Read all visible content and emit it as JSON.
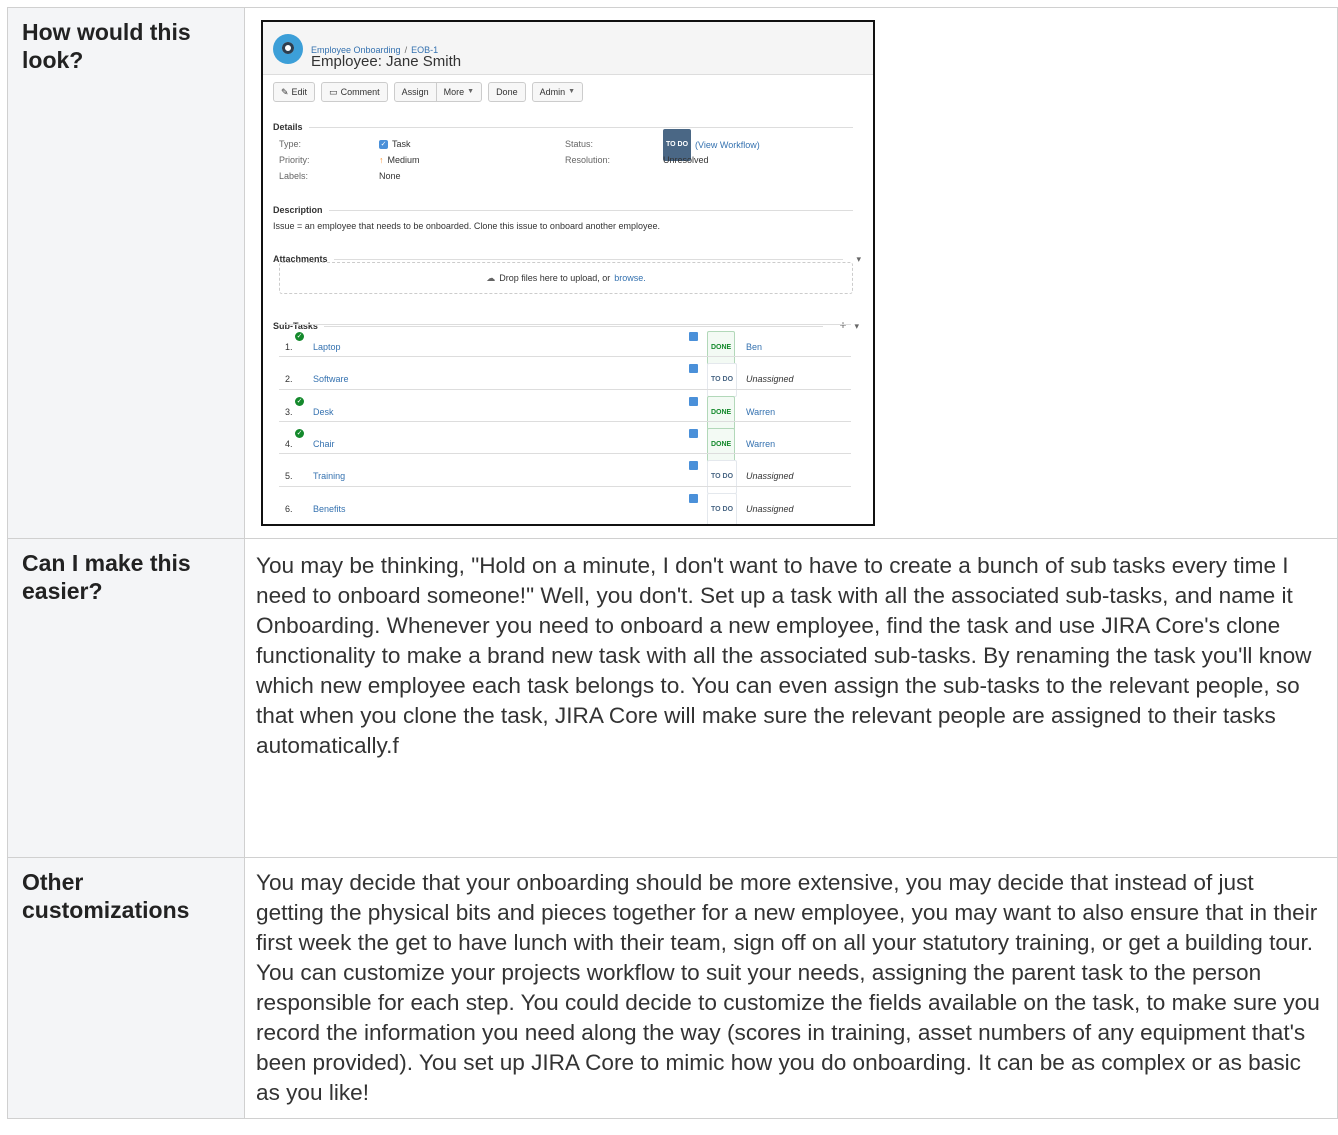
{
  "rows": [
    {
      "header": "How would this look?"
    },
    {
      "header": "Can I make this easier?",
      "body": "You may be thinking, \"Hold on a minute, I don't want to have to create a bunch of sub tasks every time I need to onboard someone!\" Well, you don't. Set up a task with all the associated sub-tasks, and name it Onboarding. Whenever you need to onboard a new employee, find the task and use JIRA Core's clone functionality to make a brand new task with all the associated sub-tasks. By renaming the task you'll know which new employee each task belongs to. You can even assign the sub-tasks to the relevant people, so that when you clone the task, JIRA Core will make sure the relevant people are assigned to their tasks automatically.f"
    },
    {
      "header": "Other customizations",
      "body": "You may decide that your onboarding should be more extensive, you may decide that instead of just getting the physical bits and pieces together for a new employee, you may want to also ensure that in their first week the get to have lunch with their team, sign off on all your statutory training, or get a building tour. You can customize your projects workflow to suit your needs, assigning the parent task to the person responsible for each step. You could decide to customize the fields available on the task, to make sure you record the information you need along the way (scores in training, asset numbers of any equipment that's been provided). You set up JIRA Core to mimic how you do onboarding. It can be as complex or as basic as you like!"
    }
  ],
  "issue": {
    "project": "Employee Onboarding",
    "key": "EOB-1",
    "title": "Employee: Jane Smith",
    "buttons": {
      "edit": "Edit",
      "comment": "Comment",
      "assign": "Assign",
      "more": "More",
      "done": "Done",
      "admin": "Admin"
    },
    "details_heading": "Details",
    "type_label": "Type:",
    "type_value": "Task",
    "priority_label": "Priority:",
    "priority_value": "Medium",
    "labels_label": "Labels:",
    "labels_value": "None",
    "status_label": "Status:",
    "status_value": "TO DO",
    "view_workflow": "(View Workflow)",
    "resolution_label": "Resolution:",
    "resolution_value": "Unresolved",
    "description_heading": "Description",
    "description": "Issue = an employee that needs to be onboarded. Clone this issue to onboard another employee.",
    "attachments_heading": "Attachments",
    "drop_text": "Drop files here to upload, or",
    "browse": "browse.",
    "subtasks_heading": "Sub-Tasks",
    "subtasks": [
      {
        "num": "1.",
        "name": "Laptop",
        "status": "DONE",
        "assignee": "Ben"
      },
      {
        "num": "2.",
        "name": "Software",
        "status": "TO DO",
        "assignee": "Unassigned"
      },
      {
        "num": "3.",
        "name": "Desk",
        "status": "DONE",
        "assignee": "Warren"
      },
      {
        "num": "4.",
        "name": "Chair",
        "status": "DONE",
        "assignee": "Warren"
      },
      {
        "num": "5.",
        "name": "Training",
        "status": "TO DO",
        "assignee": "Unassigned"
      },
      {
        "num": "6.",
        "name": "Benefits",
        "status": "TO DO",
        "assignee": "Unassigned"
      }
    ]
  }
}
